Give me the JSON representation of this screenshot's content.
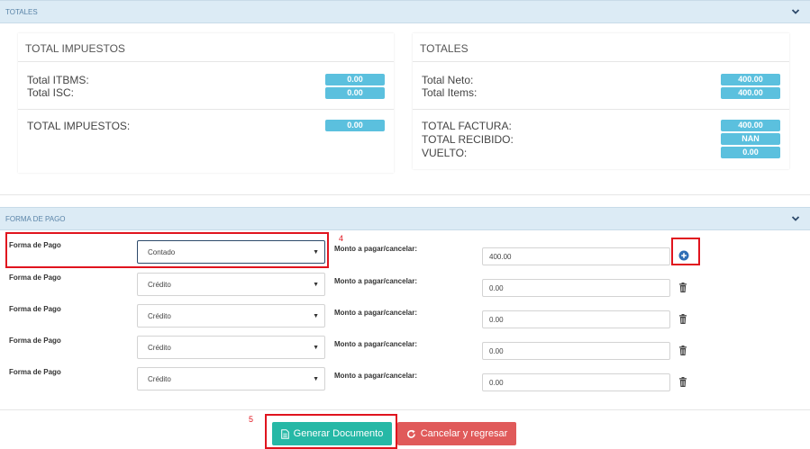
{
  "totales_panel": {
    "title": "TOTALES"
  },
  "impuestos_card": {
    "title": "TOTAL IMPUESTOS",
    "rows": [
      {
        "label": "Total ITBMS:",
        "value": "0.00"
      },
      {
        "label": "Total ISC:",
        "value": "0.00"
      }
    ],
    "total_label": "TOTAL IMPUESTOS:",
    "total_value": "0.00"
  },
  "totales_card": {
    "title": "TOTALES",
    "rows": [
      {
        "label": "Total Neto:",
        "value": "400.00"
      },
      {
        "label": "Total Items:",
        "value": "400.00"
      }
    ],
    "summary": [
      {
        "label": "TOTAL FACTURA:",
        "value": "400.00"
      },
      {
        "label": "TOTAL RECIBIDO:",
        "value": "NAN"
      },
      {
        "label": "VUELTO:",
        "value": "0.00"
      }
    ]
  },
  "forma_panel": {
    "title": "FORMA DE PAGO"
  },
  "payments": [
    {
      "label": "Forma de Pago",
      "method": "Contado",
      "monto_label": "Monto a pagar/cancelar:",
      "amount": "400.00"
    },
    {
      "label": "Forma de Pago",
      "method": "Crédito",
      "monto_label": "Monto a pagar/cancelar:",
      "amount": "0.00"
    },
    {
      "label": "Forma de Pago",
      "method": "Crédito",
      "monto_label": "Monto a pagar/cancelar:",
      "amount": "0.00"
    },
    {
      "label": "Forma de Pago",
      "method": "Crédito",
      "monto_label": "Monto a pagar/cancelar:",
      "amount": "0.00"
    },
    {
      "label": "Forma de Pago",
      "method": "Crédito",
      "monto_label": "Monto a pagar/cancelar:",
      "amount": "0.00"
    }
  ],
  "annotations": {
    "step4": "4",
    "step5": "5"
  },
  "actions": {
    "generate_label": "Generar Documento",
    "cancel_label": "Cancelar y regresar"
  },
  "icons": {
    "chevron": "chevron-down-icon",
    "add": "plus-circle-icon",
    "trash": "trash-icon",
    "document": "file-text-icon",
    "refresh": "refresh-icon"
  },
  "colors": {
    "badge": "#5bc0de",
    "panel_header": "#dcebf5",
    "generate": "#26b8a6",
    "cancel": "#e05a5a",
    "highlight": "#e0141e",
    "add_icon": "#2f6eb5"
  }
}
